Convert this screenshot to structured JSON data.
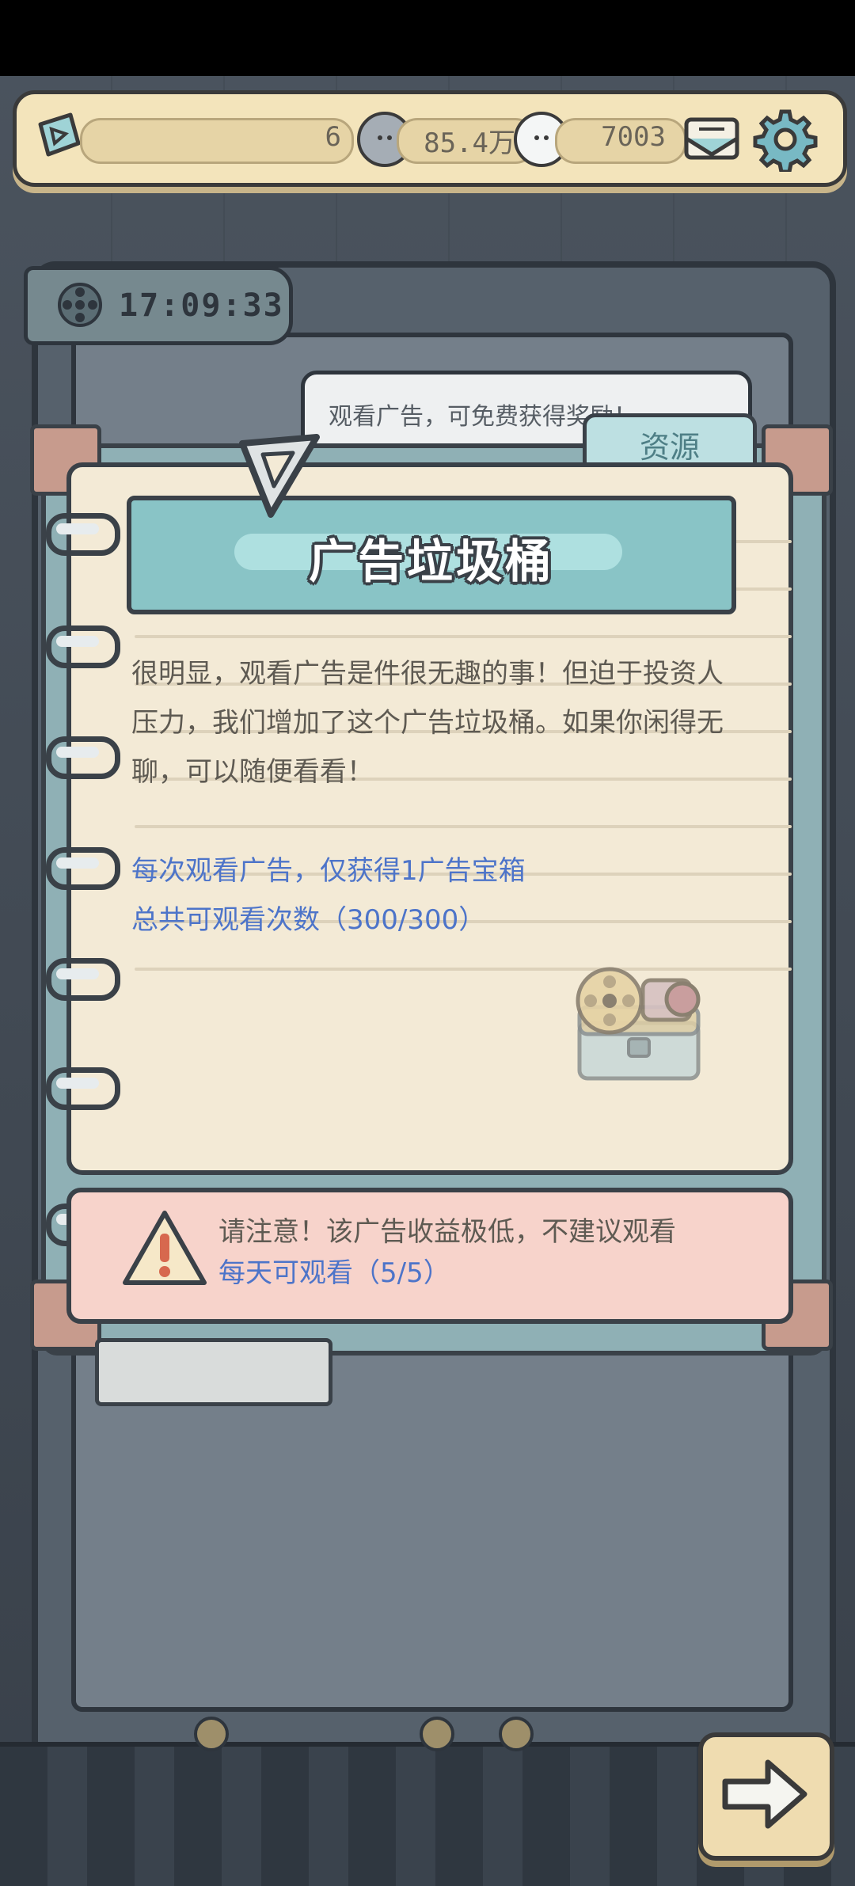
{
  "top_bar": {
    "level_value": "6",
    "currency_a_value": "85.4万",
    "currency_b_value": "7003",
    "icons": [
      "ticket-icon",
      "ghost-coin-icon",
      "ghost-bubble-icon",
      "mail-icon",
      "gear-icon"
    ]
  },
  "timer": {
    "value": "17:09:33"
  },
  "speech": {
    "text": "观看广告，可免费获得奖励！"
  },
  "notebook": {
    "tab_label": "资源",
    "title": "广告垃圾桶",
    "description": "很明显，观看广告是件很无趣的事！但迫于投资人压力，我们增加了这个广告垃圾桶。如果你闲得无聊，可以随便看看！",
    "reward_line": "每次观看广告，仅获得1广告宝箱",
    "total_line": "总共可观看次数（300/300）"
  },
  "warning": {
    "line1": "请注意！该广告收益极低，不建议观看",
    "line2": "每天可观看（5/5）"
  },
  "colors": {
    "paper": "#f3ead6",
    "banner": "#89c4c6",
    "warning_bg": "#f7d3cb",
    "blue_text": "#4d74c9",
    "outline": "#3a4148"
  }
}
